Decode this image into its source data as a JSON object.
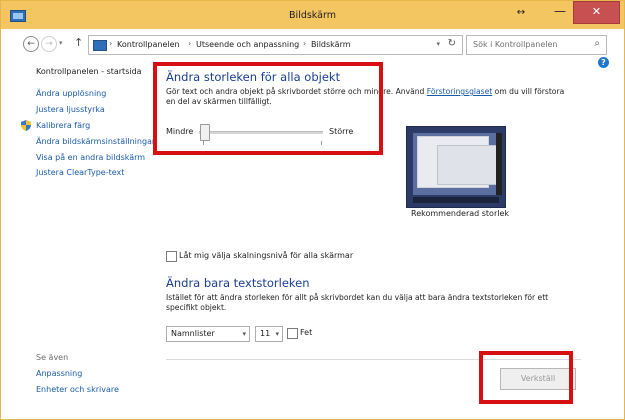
{
  "window": {
    "title": "Bildskärm",
    "resize_glyph": "↔",
    "min_glyph": "—",
    "close_glyph": "✕"
  },
  "nav": {
    "back_glyph": "←",
    "forward_glyph": "→",
    "dropdown_glyph": "▾",
    "up_glyph": "↑",
    "refresh_glyph": "↻"
  },
  "breadcrumb": {
    "sep": "›",
    "items": [
      "Kontrollpanelen",
      "Utseende och anpassning",
      "Bildskärm"
    ]
  },
  "search": {
    "placeholder": "Sök i Kontrollpanelen",
    "icon_glyph": "⌕"
  },
  "help": {
    "label": "?"
  },
  "sidebar": {
    "home": "Kontrollpanelen - startsida",
    "items": [
      "Ändra upplösning",
      "Justera ljusstyrka",
      "Kalibrera färg",
      "Ändra bildskärmsinställningar",
      "Visa på en andra bildskärm",
      "Justera ClearType-text"
    ],
    "see_also_title": "Se även",
    "see_also": [
      "Anpassning",
      "Enheter och skrivare"
    ]
  },
  "main": {
    "heading": "Ändra storleken för alla objekt",
    "description_prefix": "Gör text och andra objekt på skrivbordet större och mindre. Använd ",
    "description_link": "Förstoringsglaset",
    "description_suffix": " om du vill förstora en del av skärmen tillfälligt.",
    "slider_min_label": "Mindre",
    "slider_max_label": "Större",
    "slider_value": 0,
    "preview_caption": "Rekommenderad storlek",
    "checkbox_scaling_label": "Låt mig välja skalningsnivå för alla skärmar",
    "text_heading": "Ändra bara textstorleken",
    "text_description": "Istället för att ändra storleken för allt på skrivbordet kan du välja att bara ändra textstorleken för ett specifikt objekt.",
    "element_select_value": "Namnlister",
    "size_select_value": "11",
    "select_arrow_glyph": "▾",
    "bold_label": "Fet",
    "apply_button": "Verkställ"
  },
  "colors": {
    "titlebar": "#f4c661",
    "heading": "#1a3f8e",
    "link": "#1a5ba8",
    "annotation": "#d70f10"
  }
}
